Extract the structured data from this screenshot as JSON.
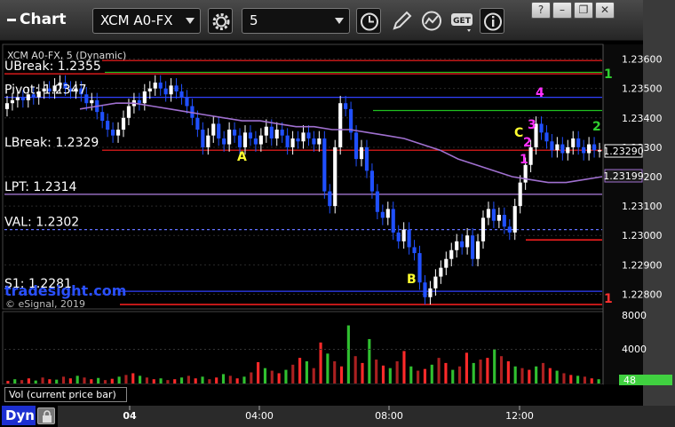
{
  "toolbar": {
    "title": "Chart",
    "symbol": "XCM A0-FX",
    "interval": "5",
    "get_label": "GET"
  },
  "window_buttons": {
    "help": "?",
    "minimize": "–",
    "restore": "❐",
    "close": "✕"
  },
  "chart_title": "XCM A0-FX, 5 (Dynamic)",
  "watermark": {
    "brand": "tradesight.com",
    "copyright": "© eSignal, 2019"
  },
  "levels": [
    {
      "name": "UBreak",
      "label": "UBreak: 1.2355",
      "value": 1.2355,
      "color": "#ff2020",
      "style": "solid",
      "show_label": true
    },
    {
      "name": "Pivot",
      "label": "Pivot: 1.2347",
      "value": 1.2347,
      "color": "#3040ff",
      "style": "solid",
      "show_label": true
    },
    {
      "name": "LBreak",
      "label": "LBreak: 1.2329",
      "value": 1.2329,
      "color": "#ff2020",
      "style": "solid",
      "show_label": true
    },
    {
      "name": "LPT",
      "label": "LPT: 1.2314",
      "value": 1.2314,
      "color": "#b080e0",
      "style": "solid",
      "show_label": true
    },
    {
      "name": "VAL",
      "label": "VAL: 1.2302",
      "value": 1.2302,
      "color": "#6070ff",
      "style": "dashed",
      "show_label": true
    },
    {
      "name": "S1",
      "label": "S1: 1.2281",
      "value": 1.2281,
      "color": "#3040ff",
      "style": "solid",
      "show_label": true
    },
    {
      "name": "R1",
      "label": "",
      "value": 1.23595,
      "color": "#ff2020",
      "style": "solid",
      "show_label": false
    },
    {
      "name": "Green1",
      "label": "",
      "value": 1.23555,
      "color": "#20c020",
      "style": "solid",
      "show_label": false
    },
    {
      "name": "Green2",
      "label": "",
      "value": 1.23425,
      "color": "#20c020",
      "style": "solid",
      "show_label": false
    }
  ],
  "price_axis": {
    "ticks": [
      "1.23600",
      "1.23500",
      "1.23400",
      "1.23300",
      "1.23200",
      "1.23100",
      "1.23000",
      "1.22900",
      "1.22800"
    ],
    "last_price": "1.23290",
    "ma_value": "1.23199"
  },
  "volume_axis": {
    "ticks": [
      "8000",
      "4000"
    ],
    "last_volume": "48"
  },
  "time_axis": {
    "ticks": [
      "04",
      "04:00",
      "08:00",
      "12:00"
    ]
  },
  "annotations": {
    "A": "A",
    "B": "B",
    "C": "C",
    "one": "1",
    "two": "2",
    "m1": "1",
    "m2": "2",
    "m3": "3",
    "m4": "4"
  },
  "volume_label": "Vol (current price bar)",
  "status": {
    "dyn": "Dyn"
  },
  "chart_data": {
    "type": "candlestick",
    "title": "XCM A0-FX, 5 (Dynamic)",
    "ylim": [
      1.2275,
      1.2365
    ],
    "x_ticks": [
      "04",
      "04:00",
      "08:00",
      "12:00"
    ],
    "y_ticks": [
      1.236,
      1.235,
      1.234,
      1.233,
      1.232,
      1.231,
      1.23,
      1.229,
      1.228
    ],
    "last_price": 1.2329,
    "moving_average_last": 1.23199,
    "close_path": [
      1.2345,
      1.2346,
      1.2347,
      1.2346,
      1.2348,
      1.2347,
      1.2349,
      1.235,
      1.2349,
      1.2351,
      1.2352,
      1.235,
      1.2349,
      1.235,
      1.2348,
      1.2345,
      1.2346,
      1.2342,
      1.2339,
      1.2336,
      1.2334,
      1.2336,
      1.234,
      1.2344,
      1.2346,
      1.2345,
      1.2349,
      1.235,
      1.2352,
      1.235,
      1.2348,
      1.2351,
      1.2349,
      1.2347,
      1.2344,
      1.234,
      1.2336,
      1.233,
      1.2334,
      1.2338,
      1.2333,
      1.2331,
      1.2336,
      1.2334,
      1.233,
      1.2335,
      1.2333,
      1.2331,
      1.2334,
      1.2337,
      1.2333,
      1.2336,
      1.2334,
      1.233,
      1.2333,
      1.2332,
      1.2335,
      1.2333,
      1.2331,
      1.2333,
      1.2315,
      1.231,
      1.233,
      1.2345,
      1.2343,
      1.2335,
      1.2326,
      1.233,
      1.2322,
      1.2315,
      1.2308,
      1.2306,
      1.2309,
      1.2301,
      1.2298,
      1.2302,
      1.2296,
      1.2294,
      1.2284,
      1.2279,
      1.2282,
      1.2286,
      1.2289,
      1.2292,
      1.2295,
      1.2298,
      1.2296,
      1.23,
      1.2292,
      1.2298,
      1.2306,
      1.2309,
      1.2305,
      1.2307,
      1.2303,
      1.2301,
      1.231,
      1.2318,
      1.2324,
      1.233,
      1.2338,
      1.2335,
      1.2332,
      1.2329,
      1.2331,
      1.2328,
      1.233,
      1.2333,
      1.233,
      1.2328,
      1.2331,
      1.2329,
      1.2329
    ],
    "moving_average": [
      1.2343,
      1.2344,
      1.2345,
      1.2345,
      1.2344,
      1.2343,
      1.2342,
      1.2341,
      1.234,
      1.2339,
      1.2339,
      1.2338,
      1.2337,
      1.2337,
      1.2336,
      1.2336,
      1.2335,
      1.2334,
      1.2333,
      1.2331,
      1.2329,
      1.2326,
      1.2324,
      1.2322,
      1.232,
      1.2319,
      1.2318,
      1.2318,
      1.2319,
      1.232
    ],
    "volume": [
      300,
      500,
      400,
      600,
      350,
      700,
      500,
      450,
      800,
      600,
      900,
      700,
      500,
      650,
      400,
      550,
      800,
      1000,
      1200,
      900,
      700,
      500,
      600,
      400,
      500,
      700,
      900,
      600,
      800,
      500,
      700,
      1100,
      900,
      600,
      800,
      1300,
      2500,
      1800,
      1500,
      1200,
      1600,
      2200,
      3000,
      2600,
      1800,
      4800,
      3500,
      2600,
      2000,
      6800,
      3200,
      2400,
      5200,
      2800,
      2100,
      1800,
      2600,
      3800,
      2000,
      1500,
      1700,
      2200,
      3000,
      2400,
      1600,
      2000,
      3600,
      2400,
      2800,
      3000,
      4000,
      3200,
      2600,
      2000,
      1800,
      1600,
      2000,
      2400,
      1800,
      1500,
      1200,
      1000,
      900,
      800,
      600,
      500
    ]
  }
}
